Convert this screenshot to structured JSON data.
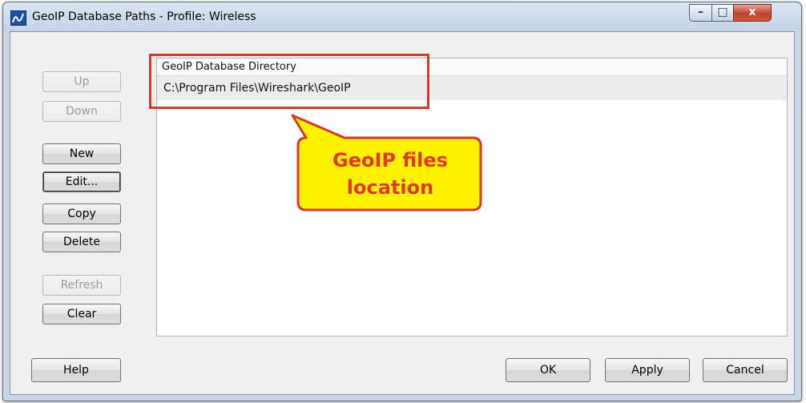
{
  "window": {
    "title": "GeoIP Database Paths - Profile: Wireless",
    "minimize_glyph": "–",
    "maximize_glyph": "□",
    "close_glyph": "x"
  },
  "side_buttons": {
    "up": "Up",
    "down": "Down",
    "new": "New",
    "edit": "Edit...",
    "copy": "Copy",
    "delete": "Delete",
    "refresh": "Refresh",
    "clear": "Clear"
  },
  "list": {
    "column_header": "GeoIP Database Directory",
    "rows": [
      "C:\\Program Files\\Wireshark\\GeoIP"
    ]
  },
  "callout": {
    "line1": "GeoIP files",
    "line2": "location"
  },
  "bottom_buttons": {
    "help": "Help",
    "ok": "OK",
    "apply": "Apply",
    "cancel": "Cancel"
  },
  "colors": {
    "annotation_red": "#d63a2a",
    "callout_fill": "#fff200"
  }
}
